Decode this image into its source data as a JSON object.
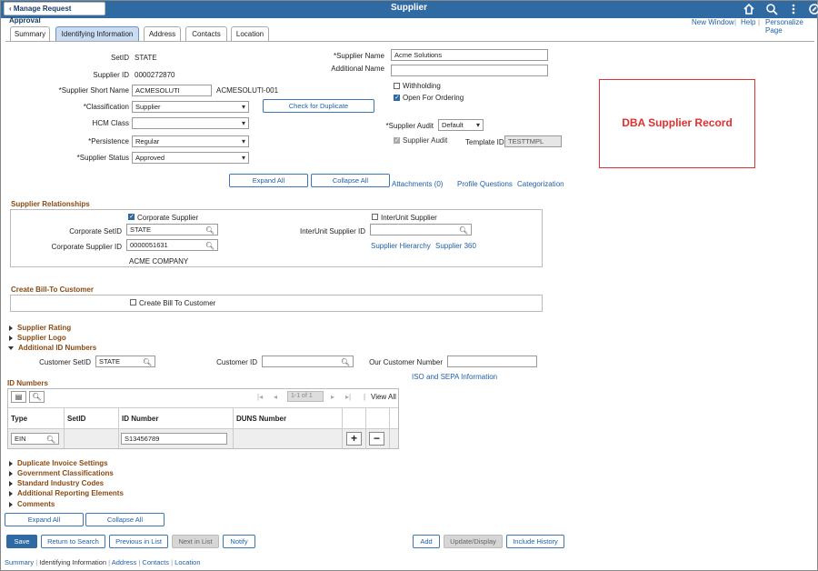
{
  "header": {
    "back_label": "Manage Request Approval",
    "title": "Supplier",
    "links": [
      "New Window",
      "Help",
      "Personalize Page"
    ]
  },
  "tabs": [
    "Summary",
    "Identifying Information",
    "Address",
    "Contacts",
    "Location"
  ],
  "form": {
    "setid_label": "SetID",
    "setid_value": "STATE",
    "supplier_id_label": "Supplier ID",
    "supplier_id_value": "0000272870",
    "short_name_label": "*Supplier Short Name",
    "short_name_value": "ACMESOLUTI",
    "short_name_extra": "ACMESOLUTI-001",
    "classification_label": "*Classification",
    "classification_value": "Supplier",
    "hcm_class_label": "HCM Class",
    "hcm_class_value": "",
    "persistence_label": "*Persistence",
    "persistence_value": "Regular",
    "status_label": "*Supplier Status",
    "status_value": "Approved",
    "check_dup_label": "Check for Duplicate",
    "supplier_name_label": "*Supplier Name",
    "supplier_name_value": "Acme Solutions",
    "additional_name_label": "Additional Name",
    "additional_name_value": "",
    "withholding_label": "Withholding",
    "open_for_ordering_label": "Open For Ordering",
    "supplier_audit_label": "*Supplier Audit",
    "supplier_audit_value": "Default",
    "supplier_audit_cb_label": "Supplier Audit",
    "template_id_label": "Template ID",
    "template_id_value": "TESTTMPL"
  },
  "dba_text": "DBA Supplier Record",
  "actions": {
    "expand_all": "Expand All",
    "collapse_all": "Collapse All",
    "attachments": "Attachments (0)",
    "profile_questions": "Profile Questions",
    "categorization": "Categorization"
  },
  "relationships": {
    "title": "Supplier Relationships",
    "corporate_supplier_label": "Corporate Supplier",
    "corp_setid_label": "Corporate SetID",
    "corp_setid_value": "STATE",
    "corp_supplier_id_label": "Corporate Supplier ID",
    "corp_supplier_id_value": "0000051631",
    "corp_name": "ACME COMPANY",
    "interunit_label": "InterUnit Supplier",
    "interunit_id_label": "InterUnit Supplier ID",
    "interunit_id_value": "",
    "hierarchy_link": "Supplier Hierarchy",
    "s360_link": "Supplier 360"
  },
  "bill_to": {
    "title": "Create Bill-To Customer",
    "cb_label": "Create Bill To Customer"
  },
  "collapsibles": [
    "Supplier Rating",
    "Supplier Logo"
  ],
  "additional_id": {
    "title": "Additional ID Numbers",
    "customer_setid_label": "Customer SetID",
    "customer_setid_value": "STATE",
    "customer_id_label": "Customer ID",
    "customer_id_value": "",
    "our_customer_label": "Our Customer Number",
    "our_customer_value": "",
    "iso_link": "ISO and SEPA Information"
  },
  "id_numbers": {
    "title": "ID Numbers",
    "pager": "1-1 of 1",
    "view_all": "View All",
    "columns": [
      "Type",
      "SetID",
      "ID Number",
      "DUNS Number"
    ],
    "row": {
      "type": "EIN",
      "setid": "",
      "id_number": "S13456789",
      "duns": ""
    }
  },
  "bottom_sections": [
    "Duplicate Invoice Settings",
    "Government Classifications",
    "Standard Industry Codes",
    "Additional Reporting Elements",
    "Comments"
  ],
  "bottom_buttons": {
    "expand_all": "Expand All",
    "collapse_all": "Collapse All",
    "save": "Save",
    "return": "Return to Search",
    "prev": "Previous in List",
    "next": "Next in List",
    "notify": "Notify",
    "add": "Add",
    "update": "Update/Display",
    "history": "Include History"
  },
  "footer_links": [
    "Summary",
    "Identifying Information",
    "Address",
    "Contacts",
    "Location"
  ],
  "colors": {
    "banner": "#2f6aa3",
    "section_title": "#8a4a13",
    "dba_red": "#e03030",
    "link": "#1f5fa8"
  }
}
